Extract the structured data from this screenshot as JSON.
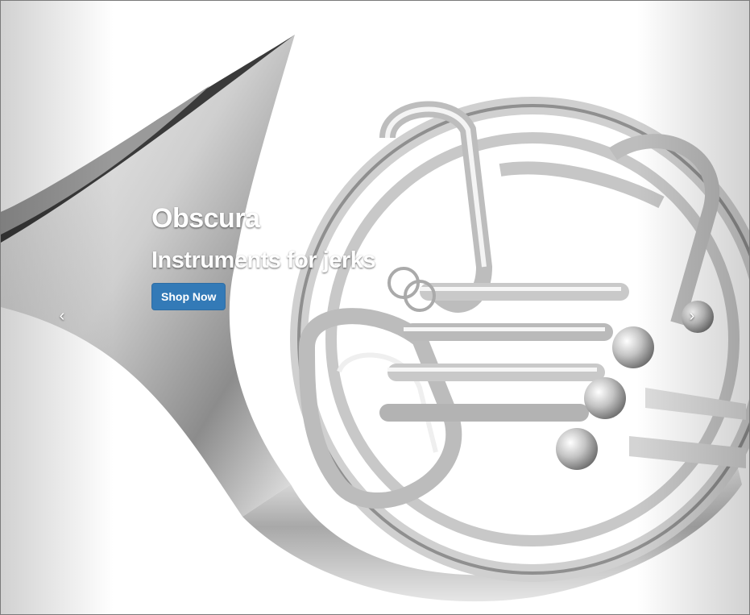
{
  "slide": {
    "title": "Obscura",
    "subtitle": "Instruments for jerks",
    "cta_label": "Shop Now",
    "image_subject": "french-horn"
  },
  "controls": {
    "prev_icon": "chevron-left-icon",
    "next_icon": "chevron-right-icon",
    "prev_glyph": "‹",
    "next_glyph": "›"
  },
  "colors": {
    "primary_button": "#337ab7",
    "caption_text": "#ffffff",
    "metal_light": "#f2f2f2",
    "metal_mid": "#bdbdbd",
    "metal_dark": "#5a5a5a"
  }
}
